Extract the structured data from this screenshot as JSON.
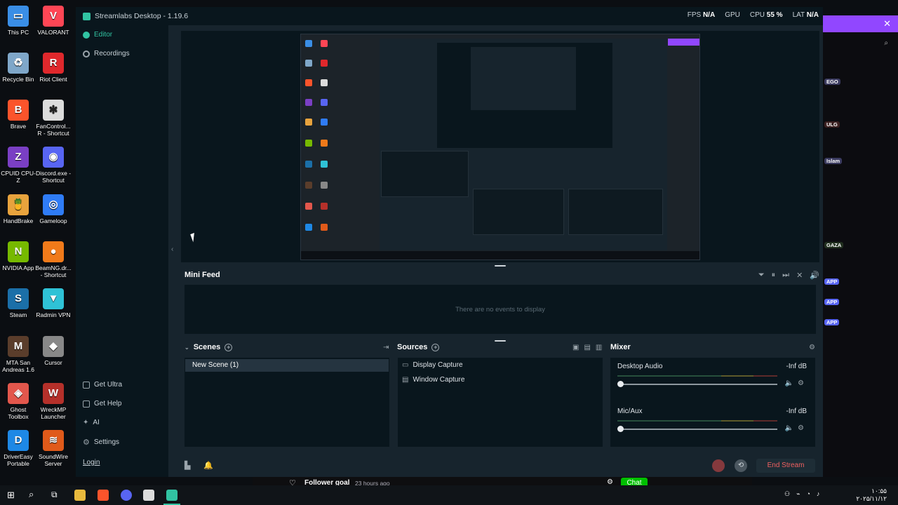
{
  "desktop_icons": [
    {
      "label": "This PC",
      "icon": "pc-icon",
      "color": "#3a8ee6"
    },
    {
      "label": "VALORANT",
      "icon": "valorant-icon",
      "color": "#ff4655"
    },
    {
      "label": "Recycle Bin",
      "icon": "recycle-bin-icon",
      "color": "#7fa7c9"
    },
    {
      "label": "Riot Client",
      "icon": "riot-client-icon",
      "color": "#e0282c"
    },
    {
      "label": "Brave",
      "icon": "brave-icon",
      "color": "#fb542b"
    },
    {
      "label": "FanControl... R - Shortcut",
      "icon": "fancontrol-icon",
      "color": "#dcdcdc"
    },
    {
      "label": "CPUID CPU-Z",
      "icon": "cpuz-icon",
      "color": "#7a3fc4"
    },
    {
      "label": "Discord.exe - Shortcut",
      "icon": "discord-icon",
      "color": "#5865f2"
    },
    {
      "label": "HandBrake",
      "icon": "handbrake-icon",
      "color": "#e8a33d"
    },
    {
      "label": "Gameloop",
      "icon": "gameloop-icon",
      "color": "#2f7cf6"
    },
    {
      "label": "NVIDIA App",
      "icon": "nvidia-icon",
      "color": "#76b900"
    },
    {
      "label": "BeamNG.dr... - Shortcut",
      "icon": "beamng-icon",
      "color": "#f07a1a"
    },
    {
      "label": "Steam",
      "icon": "steam-icon",
      "color": "#1b6fa8"
    },
    {
      "label": "Radmin VPN",
      "icon": "radmin-icon",
      "color": "#2fc2d6"
    },
    {
      "label": "MTA San Andreas 1.6",
      "icon": "mta-icon",
      "color": "#5a3d2b"
    },
    {
      "label": "Cursor",
      "icon": "cursor-app-icon",
      "color": "#888888"
    },
    {
      "label": "Ghost Toolbox",
      "icon": "ghost-toolbox-icon",
      "color": "#e2574c"
    },
    {
      "label": "WreckMP Launcher",
      "icon": "wreckmp-icon",
      "color": "#b5302a"
    },
    {
      "label": "DriverEasy Portable",
      "icon": "drivereasy-icon",
      "color": "#1e88e5"
    },
    {
      "label": "SoundWire Server",
      "icon": "soundwire-icon",
      "color": "#e05a1a"
    }
  ],
  "window": {
    "title": "Streamlabs Desktop - 1.19.6",
    "stats": {
      "fps_label": "FPS",
      "fps_value": "N/A",
      "gpu_label": "GPU",
      "cpu_label": "CPU",
      "cpu_value": "55 %",
      "lat_label": "LAT",
      "lat_value": "N/A"
    }
  },
  "nav": {
    "editor": "Editor",
    "recordings": "Recordings",
    "get_ultra": "Get Ultra",
    "get_help": "Get Help",
    "ai": "AI",
    "settings": "Settings",
    "login": "Login"
  },
  "minifeed": {
    "title": "Mini Feed",
    "empty": "There are no events to display"
  },
  "scenes": {
    "title": "Scenes",
    "items": [
      "New Scene (1)"
    ]
  },
  "sources": {
    "title": "Sources",
    "items": [
      {
        "label": "Display Capture",
        "icon": "display-icon"
      },
      {
        "label": "Window Capture",
        "icon": "window-icon"
      }
    ]
  },
  "mixer": {
    "title": "Mixer",
    "channels": [
      {
        "name": "Desktop Audio",
        "level": "-Inf dB",
        "volume": 0
      },
      {
        "name": "Mic/Aux",
        "level": "-Inf dB",
        "volume": 0
      }
    ]
  },
  "footer": {
    "end_stream": "End Stream"
  },
  "twitch": {
    "goal": "Follower goal",
    "goal_ago": "23 hours ago",
    "chat_button": "Chat",
    "accent": "#9147ff"
  },
  "chat_badges": [
    "EGO",
    "ULG",
    "Islam",
    "GAZA",
    "APP",
    "APP",
    "APP"
  ],
  "colors": {
    "accent": "#31c3a2",
    "danger": "#f06060",
    "bg": "#17242d",
    "panel": "#09161d"
  }
}
